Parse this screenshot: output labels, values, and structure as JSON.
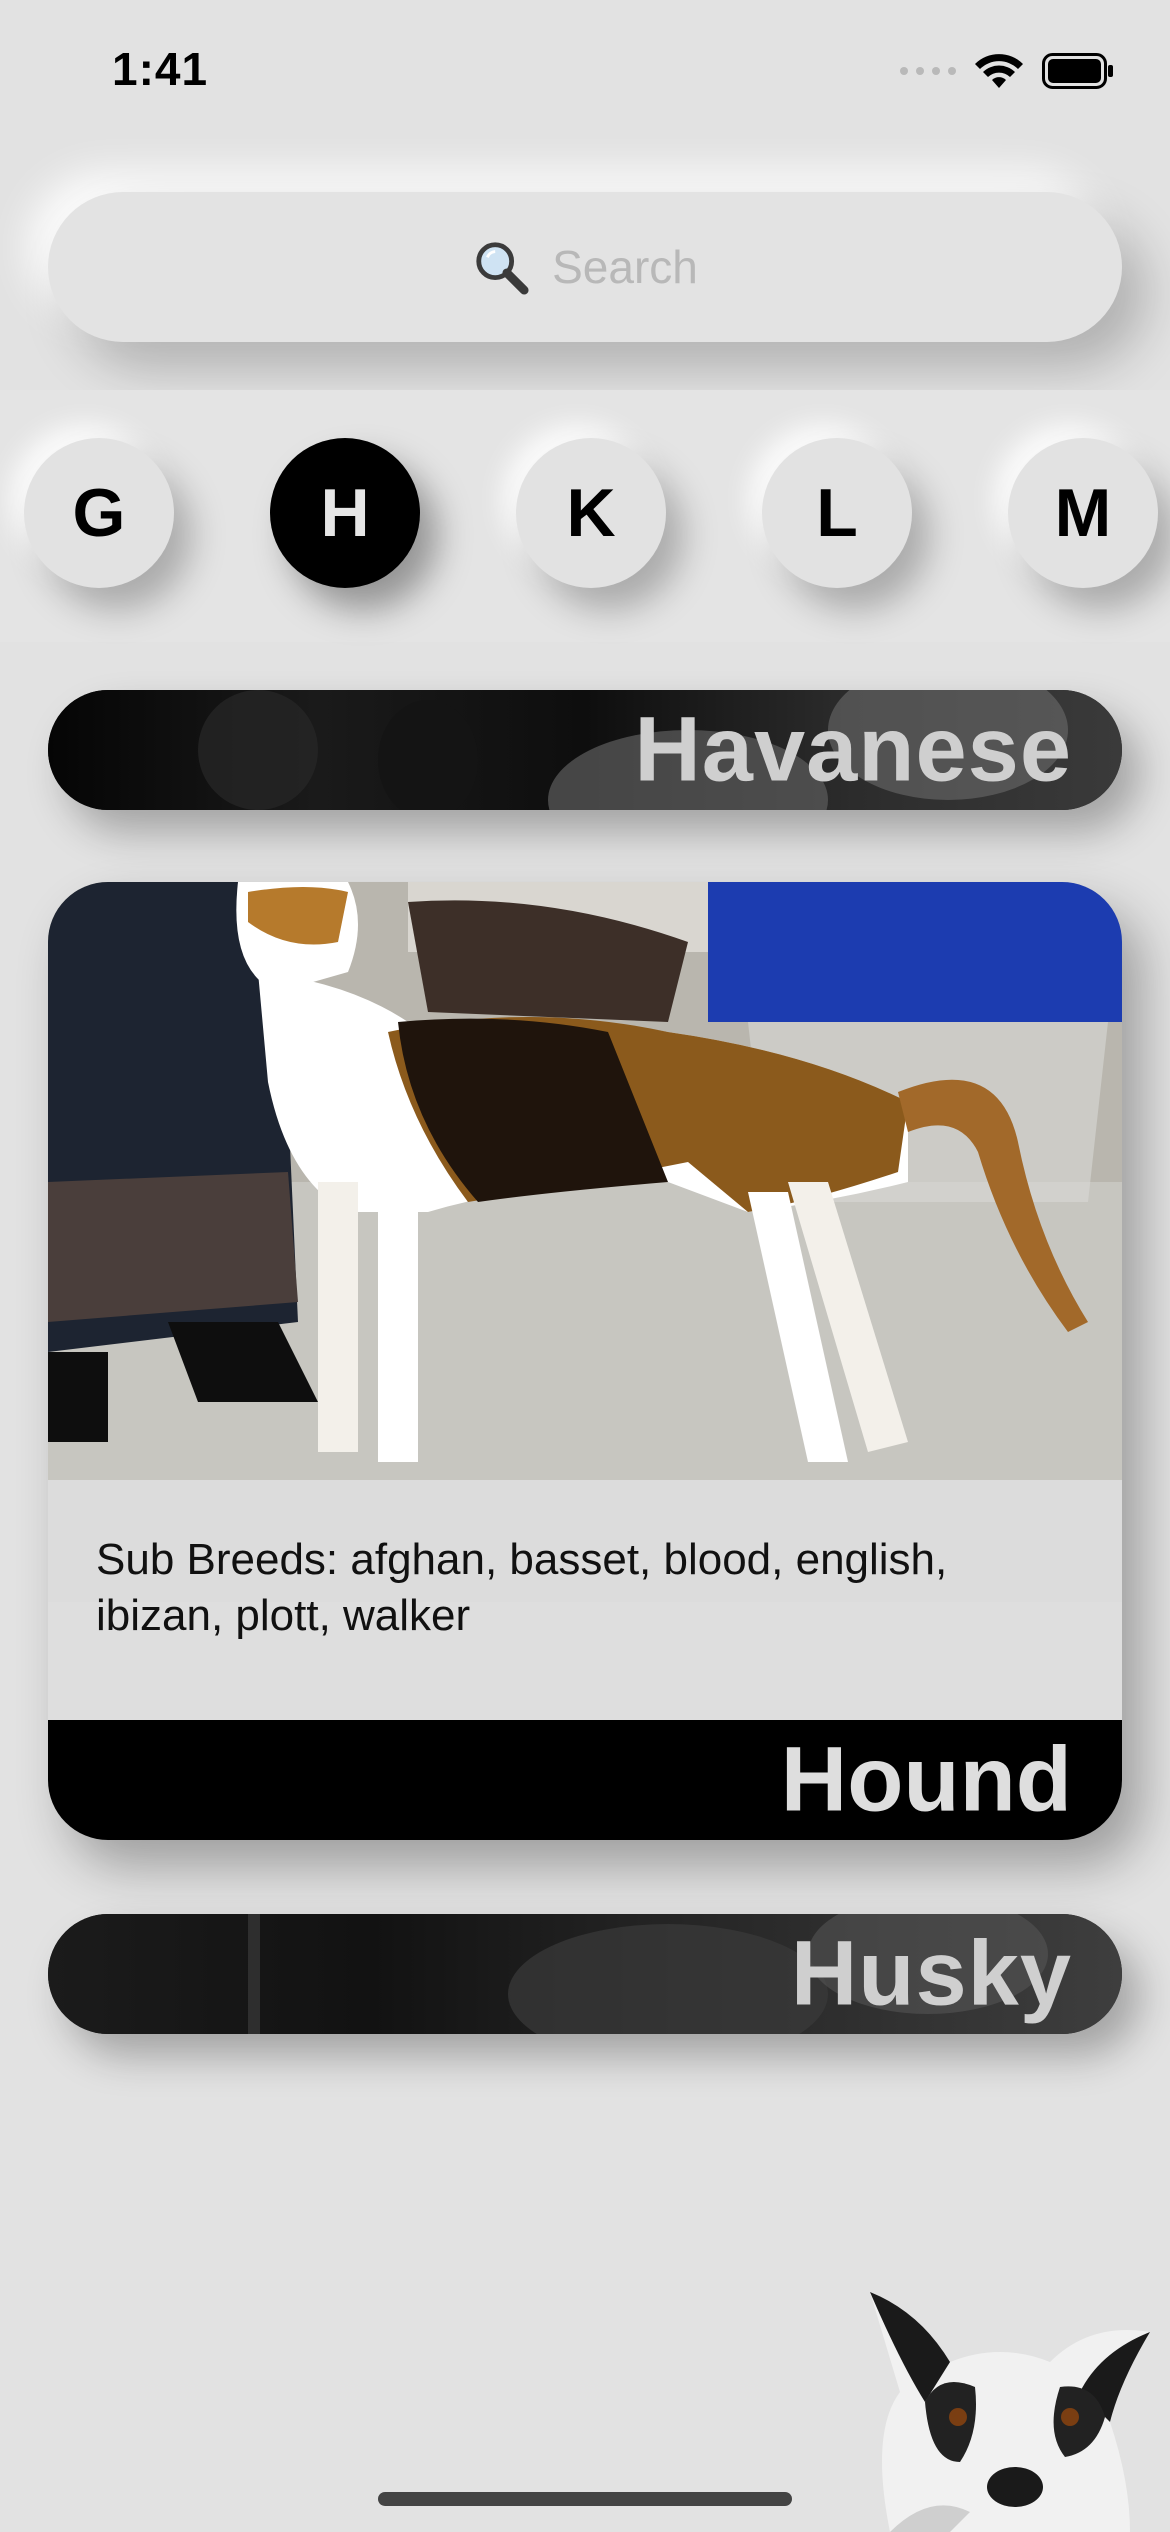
{
  "status_bar": {
    "time": "1:41"
  },
  "search": {
    "placeholder": "Search"
  },
  "letters": [
    "G",
    "H",
    "K",
    "L",
    "M"
  ],
  "selected_letter": "H",
  "breeds": [
    {
      "name": "Havanese",
      "expanded": false
    },
    {
      "name": "Hound",
      "expanded": true,
      "sub_breeds": "Sub Breeds: afghan, basset, blood, english, ibizan, plott, walker"
    },
    {
      "name": "Husky",
      "expanded": false
    }
  ],
  "icons": [
    "signal-dots-icon",
    "wifi-icon",
    "battery-icon",
    "search-icon",
    "dog-mascot-icon"
  ]
}
